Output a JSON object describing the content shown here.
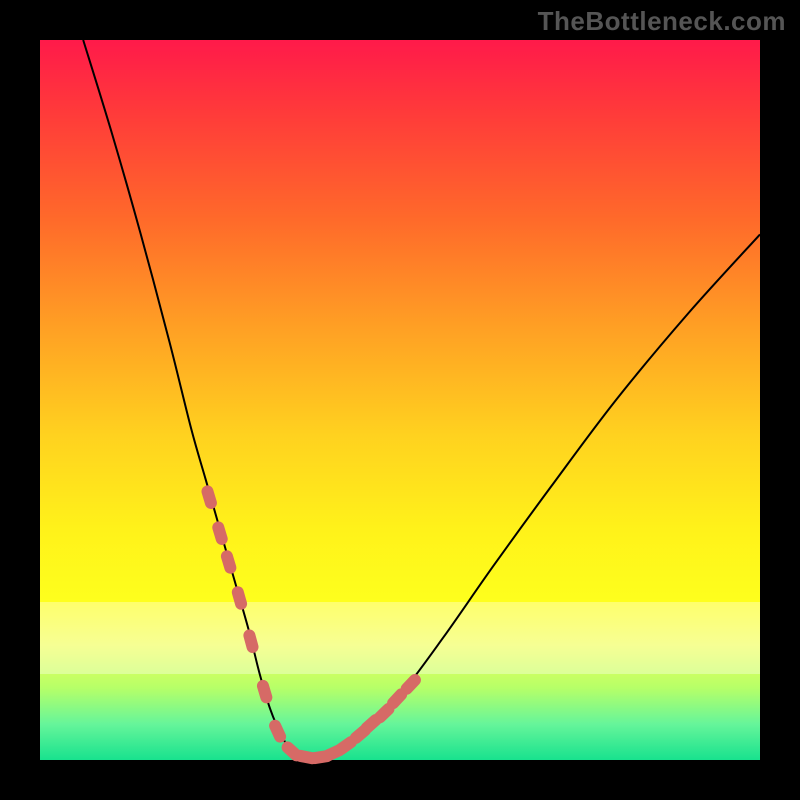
{
  "watermark": "TheBottleneck.com",
  "colors": {
    "frame_bg": "#000000",
    "curve": "#000000",
    "markers": "#d66a66",
    "gradient_stops": [
      "#ff1a4a",
      "#ff3a3a",
      "#ff6a2a",
      "#ffa024",
      "#ffd21f",
      "#fff21a",
      "#feff1d",
      "#f2ff5a",
      "#b6ff68",
      "#66f59a",
      "#18e28e"
    ]
  },
  "chart_data": {
    "type": "line",
    "title": "",
    "xlabel": "",
    "ylabel": "",
    "xlim": [
      0,
      100
    ],
    "ylim": [
      0,
      100
    ],
    "grid": false,
    "series": [
      {
        "name": "bottleneck-curve",
        "x": [
          6,
          10,
          14,
          18,
          21,
          23,
          25,
          27,
          29,
          30.5,
          32,
          33.5,
          35,
          37,
          39,
          41,
          45,
          50,
          56,
          63,
          71,
          80,
          90,
          100
        ],
        "y": [
          100,
          87,
          73,
          58,
          46,
          39,
          32,
          25,
          18,
          12,
          7,
          3.5,
          1.2,
          0.4,
          0.4,
          1.2,
          4,
          9,
          17,
          27,
          38,
          50,
          62,
          73
        ]
      }
    ],
    "markers": {
      "name": "highlighted-points",
      "x": [
        23.5,
        25.0,
        26.2,
        27.7,
        29.3,
        31.2,
        33.0,
        35.0,
        37.0,
        39.0,
        40.8,
        42.5,
        44.5,
        46.0,
        47.8,
        49.6,
        51.5
      ],
      "y": [
        36.5,
        31.5,
        27.5,
        22.5,
        16.5,
        9.5,
        4.0,
        1.2,
        0.4,
        0.4,
        1.0,
        2.0,
        3.6,
        5.0,
        6.5,
        8.5,
        10.5
      ]
    },
    "bands": [
      {
        "name": "pale-band",
        "y_from": 12,
        "y_to": 22
      }
    ]
  }
}
